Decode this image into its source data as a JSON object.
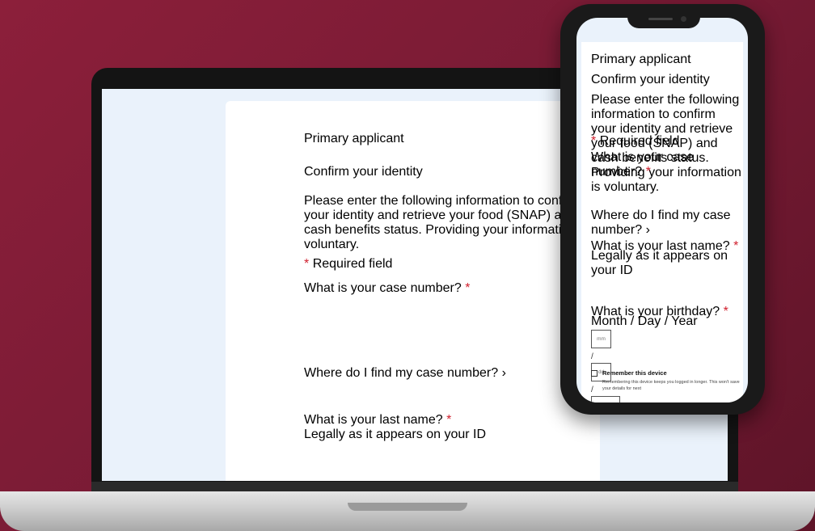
{
  "form": {
    "eyebrow": "Primary applicant",
    "title": "Confirm your identity",
    "intro": "Please enter the following information to confirm your identity and retrieve your food (SNAP) and cash benefits status. Providing your information is voluntary.",
    "required_star": "*",
    "required_label": "Required field",
    "case_number_label": "What is your case number?",
    "case_help_link": "Where do I find my case number?",
    "help_chevron": "›",
    "last_name_label": "What is your last name?",
    "last_name_hint": "Legally as it appears on your ID",
    "birthday_label": "What is your birthday?",
    "birthday_hint": "Month / Day / Year",
    "month_placeholder": "mm",
    "day_placeholder": "dd",
    "year_placeholder": "yyyy",
    "date_separator": "/",
    "remember_title": "Remember this device",
    "remember_text": "Remembering this device keeps you logged in longer. This won't save your details for next"
  },
  "colors": {
    "background": "#7a1b35",
    "accent_purple": "#7a2b7f",
    "required_red": "#d0202e",
    "page_bg": "#eaf2fb"
  }
}
